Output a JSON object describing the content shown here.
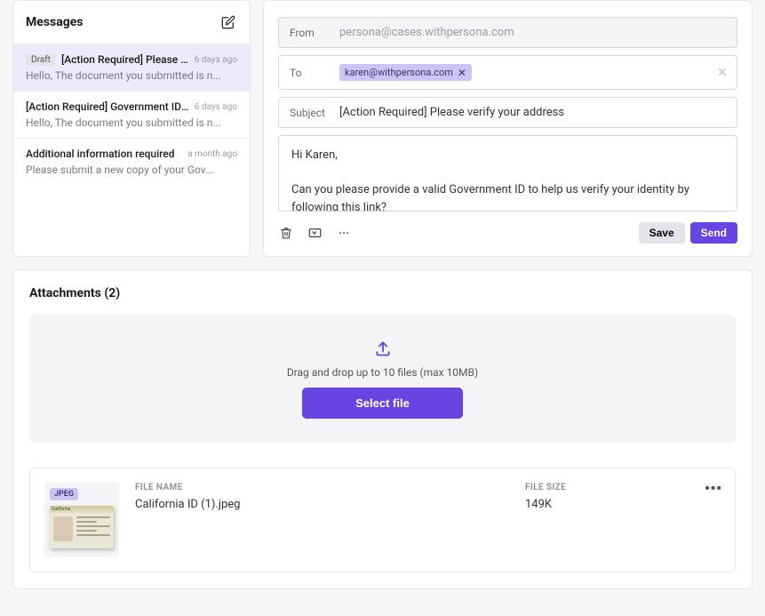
{
  "messages": {
    "header": "Messages",
    "items": [
      {
        "draft": true,
        "subject": "[Action Required] Please verify yo...",
        "time": "6 days ago",
        "preview": "Hello, The document you submitted is n..."
      },
      {
        "draft": false,
        "subject": "[Action Required] Government ID is req...",
        "time": "6 days ago",
        "preview": "Hello, The document you submitted is n..."
      },
      {
        "draft": false,
        "subject": "Additional information required",
        "time": "a month ago",
        "preview": "Please submit a new copy of your Gov..."
      }
    ],
    "draft_label": "Draft"
  },
  "compose": {
    "labels": {
      "from": "From",
      "to": "To",
      "subject": "Subject"
    },
    "from_placeholder": "persona@cases.withpersona.com",
    "to_chip": "karen@withpersona.com",
    "subject": "[Action Required] Please verify your address",
    "body_line1": "Hi Karen,",
    "body_line2": "Can you please provide a valid Government ID to help us verify your identity by following this link?",
    "save": "Save",
    "send": "Send"
  },
  "attachments": {
    "header": "Attachments (2)",
    "hint": "Drag and drop up to 10 files (max 10MB)",
    "select": "Select file",
    "col_name": "FILE NAME",
    "col_size": "FILE SIZE",
    "file": {
      "badge": "JPEG",
      "thumb_text": "California",
      "name": "California ID (1).jpeg",
      "size": "149K"
    }
  }
}
